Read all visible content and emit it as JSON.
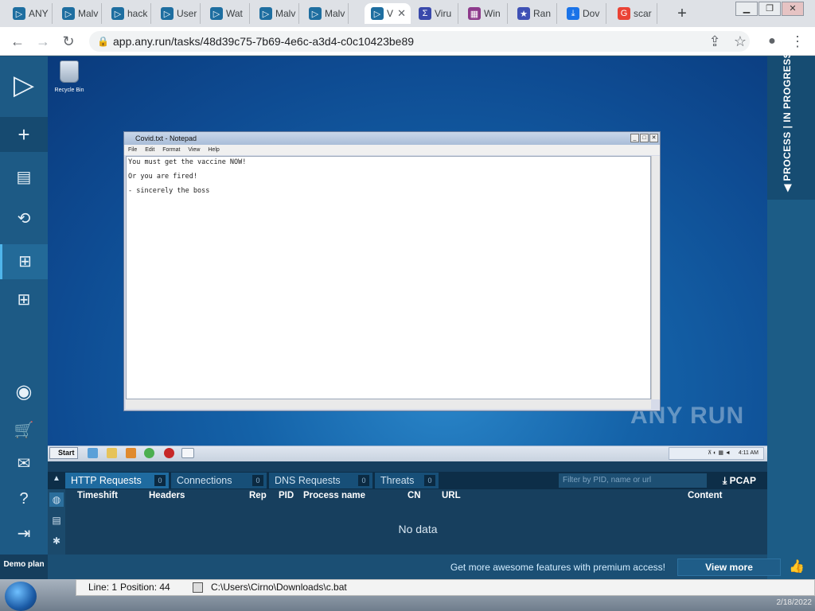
{
  "browser": {
    "tabs": [
      {
        "label": "ANY",
        "favicon": "anyrun-icon"
      },
      {
        "label": "Malv",
        "favicon": "anyrun-icon"
      },
      {
        "label": "hack",
        "favicon": "anyrun-icon"
      },
      {
        "label": "User",
        "favicon": "anyrun-icon"
      },
      {
        "label": "Wat",
        "favicon": "anyrun-icon"
      },
      {
        "label": "Malv",
        "favicon": "anyrun-icon"
      },
      {
        "label": "Malv",
        "favicon": "anyrun-icon"
      },
      {
        "label": "V",
        "favicon": "anyrun-icon",
        "active": true
      },
      {
        "label": "Viru",
        "favicon": "virustotal-icon"
      },
      {
        "label": "Win",
        "favicon": "winrar-icon"
      },
      {
        "label": "Ran",
        "favicon": "star-icon"
      },
      {
        "label": "Dov",
        "favicon": "download-icon"
      },
      {
        "label": "scar",
        "favicon": "google-icon"
      }
    ],
    "url": "app.any.run/tasks/48d39c75-7b69-4e6c-a3d4-c0c10423be89"
  },
  "sidebar": {
    "demo_plan": "Demo plan"
  },
  "right_panel": {
    "process_label": "PROCESS | IN PROGRESS"
  },
  "desktop": {
    "recycle_bin_label": "Recycle Bin",
    "watermark": "ANY RUN"
  },
  "notepad": {
    "title": "Covid.txt - Notepad",
    "menu": [
      "File",
      "Edit",
      "Format",
      "View",
      "Help"
    ],
    "lines": [
      "You must get the vaccine NOW!",
      "Or you are fired!",
      "- sincerely the boss"
    ]
  },
  "vm_taskbar": {
    "start_label": "Start",
    "clock": "4:11 AM"
  },
  "network_panel": {
    "tabs": [
      {
        "label": "HTTP Requests",
        "count": "0"
      },
      {
        "label": "Connections",
        "count": "0"
      },
      {
        "label": "DNS Requests",
        "count": "0"
      },
      {
        "label": "Threats",
        "count": "0"
      }
    ],
    "filter_placeholder": "Filter by PID, name or url",
    "pcap_label": "PCAP",
    "columns": [
      "Timeshift",
      "Headers",
      "Rep",
      "PID",
      "Process name",
      "CN",
      "URL",
      "Content"
    ],
    "empty_text": "No data"
  },
  "promo": {
    "text": "Get more awesome features with premium access!",
    "button": "View more"
  },
  "host_statusbar": {
    "line": "Line: 1",
    "position": "Position: 44",
    "path": "C:\\Users\\Cirno\\Downloads\\c.bat",
    "date": "2/18/2022"
  },
  "colors": {
    "anyrun_blue": "#1d5a85",
    "active_tab": "#1f6ba0"
  }
}
